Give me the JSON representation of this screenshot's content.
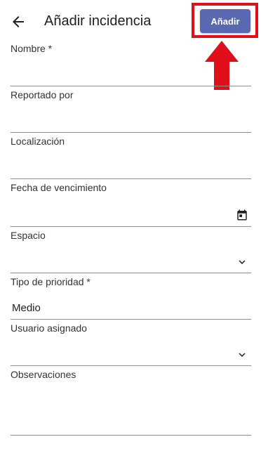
{
  "header": {
    "title": "Añadir incidencia",
    "add_button_label": "Añadir",
    "back_icon": "arrow-left-icon",
    "highlight_color": "#e0101b",
    "arrow_color": "#e0101b",
    "button_color": "#5a68b1"
  },
  "form": {
    "nombre": {
      "label": "Nombre *",
      "value": ""
    },
    "reportado_por": {
      "label": "Reportado por",
      "value": ""
    },
    "localizacion": {
      "label": "Localización",
      "value": ""
    },
    "fecha_vencimiento": {
      "label": "Fecha de vencimiento",
      "value": "",
      "icon": "calendar-icon"
    },
    "espacio": {
      "label": "Espacio",
      "value": "",
      "icon": "chevron-down-icon"
    },
    "tipo_prioridad": {
      "label": "Tipo de prioridad *",
      "value": "Medio"
    },
    "usuario_asignado": {
      "label": "Usuario asignado",
      "value": "",
      "icon": "chevron-down-icon"
    },
    "observaciones": {
      "label": "Observaciones",
      "value": ""
    }
  }
}
